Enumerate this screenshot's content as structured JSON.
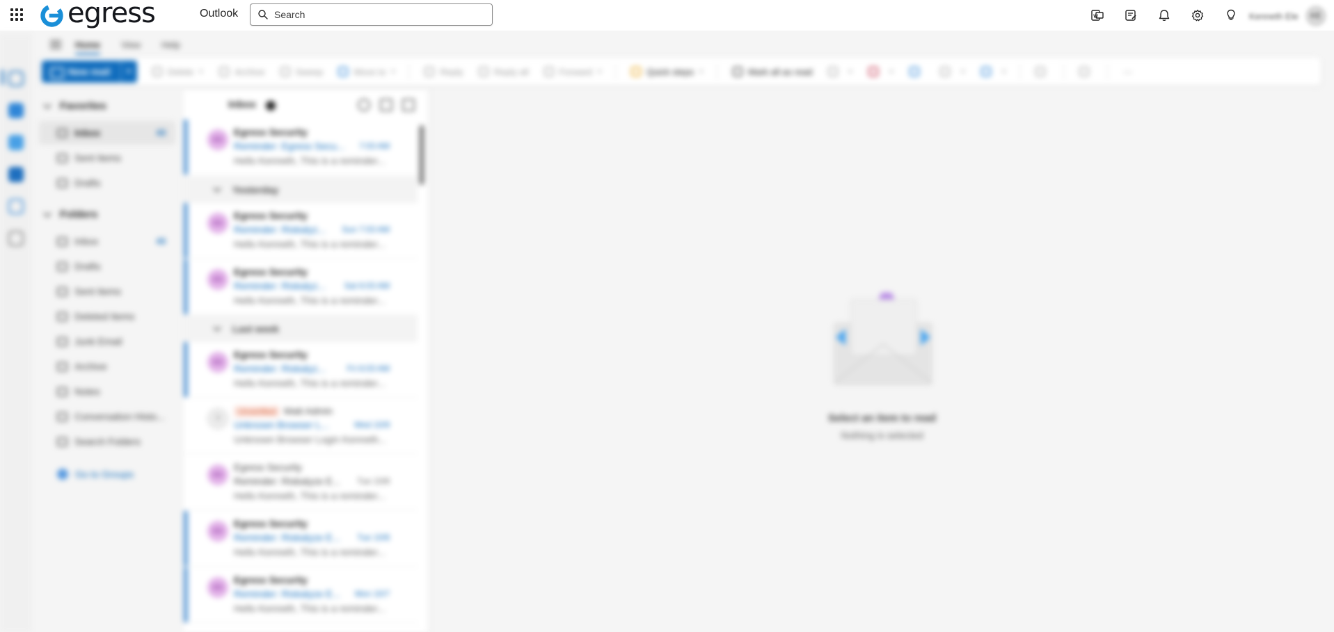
{
  "topbar": {
    "brand": "egress",
    "app_name": "Outlook",
    "search_placeholder": "Search",
    "icons": [
      "word-icon",
      "notes-icon",
      "bell-icon",
      "settings-icon",
      "lightbulb-icon"
    ],
    "account_name": "Kenneth Ele",
    "account_initials": "KE"
  },
  "colors": {
    "accent": "#0f6cbd",
    "brand": "#1a8fd8",
    "unread_bar": "#5b9ad6",
    "avatar_bg": "#e3b3e9"
  },
  "rail": {
    "icons": [
      "mail-icon",
      "calendar-icon",
      "people-icon",
      "teams-icon",
      "todo-icon",
      "apps-icon"
    ]
  },
  "ribbon": {
    "tabs": [
      "Home",
      "View",
      "Help"
    ],
    "new_mail": "New mail",
    "buttons": [
      "Delete",
      "Archive",
      "Sweep",
      "Move to",
      "Reply",
      "Reply all",
      "Forward",
      "Quick steps",
      "Mark all as read"
    ]
  },
  "folders": {
    "favorites_title": "Favorites",
    "favorites": [
      {
        "label": "Inbox",
        "count": "43"
      },
      {
        "label": "Sent Items",
        "count": ""
      },
      {
        "label": "Drafts",
        "count": ""
      }
    ],
    "folders_title": "Folders",
    "items": [
      {
        "label": "Inbox",
        "count": "43"
      },
      {
        "label": "Drafts",
        "count": ""
      },
      {
        "label": "Sent Items",
        "count": ""
      },
      {
        "label": "Deleted Items",
        "count": ""
      },
      {
        "label": "Junk Email",
        "count": ""
      },
      {
        "label": "Archive",
        "count": ""
      },
      {
        "label": "Notes",
        "count": ""
      },
      {
        "label": "Conversation Histo...",
        "count": ""
      },
      {
        "label": "Search Folders",
        "count": ""
      }
    ],
    "groups_link": "Go to Groups"
  },
  "list": {
    "title": "Inbox",
    "groups": [
      "Yesterday",
      "Last week"
    ],
    "messages": [
      {
        "initials": "ES",
        "from": "Egress Security",
        "tag": "",
        "subject": "Reminder: Egress Secu...",
        "time": "7:03 AM",
        "preview": "Hello Kenneth, This is a reminder..."
      },
      {
        "initials": "ES",
        "from": "Egress Security",
        "tag": "",
        "subject": "Reminder: Riskalyz...",
        "time": "Sun 7:03 AM",
        "preview": "Hello Kenneth, This is a reminder..."
      },
      {
        "initials": "ES",
        "from": "Egress Security",
        "tag": "",
        "subject": "Reminder: Riskalyz...",
        "time": "Sat 6:03 AM",
        "preview": "Hello Kenneth, This is a reminder..."
      },
      {
        "initials": "ES",
        "from": "Egress Security",
        "tag": "",
        "subject": "Reminder: Riskalyz...",
        "time": "Fri 6:03 AM",
        "preview": "Hello Kenneth, This is a reminder..."
      },
      {
        "initials": "?",
        "from": "Matt Admin",
        "tag": "Unverified",
        "subject": "Unknown Browser L...",
        "time": "Wed 10/9",
        "preview": "Unknown Browser Login Kenneth..."
      },
      {
        "initials": "ES",
        "from": "Egress Security",
        "tag": "",
        "subject": "Reminder: Riskalyze E...",
        "time": "Tue 10/8",
        "preview": "Hello Kenneth, This is a reminder..."
      },
      {
        "initials": "ES",
        "from": "Egress Security",
        "tag": "",
        "subject": "Reminder: Riskalyze E...",
        "time": "Tue 10/8",
        "preview": "Hello Kenneth, This is a reminder..."
      },
      {
        "initials": "ES",
        "from": "Egress Security",
        "tag": "",
        "subject": "Reminder: Riskalyze E...",
        "time": "Mon 10/7",
        "preview": "Hello Kenneth, This is a reminder..."
      }
    ]
  },
  "reading": {
    "empty_title": "Select an item to read",
    "empty_sub": "Nothing is selected"
  }
}
